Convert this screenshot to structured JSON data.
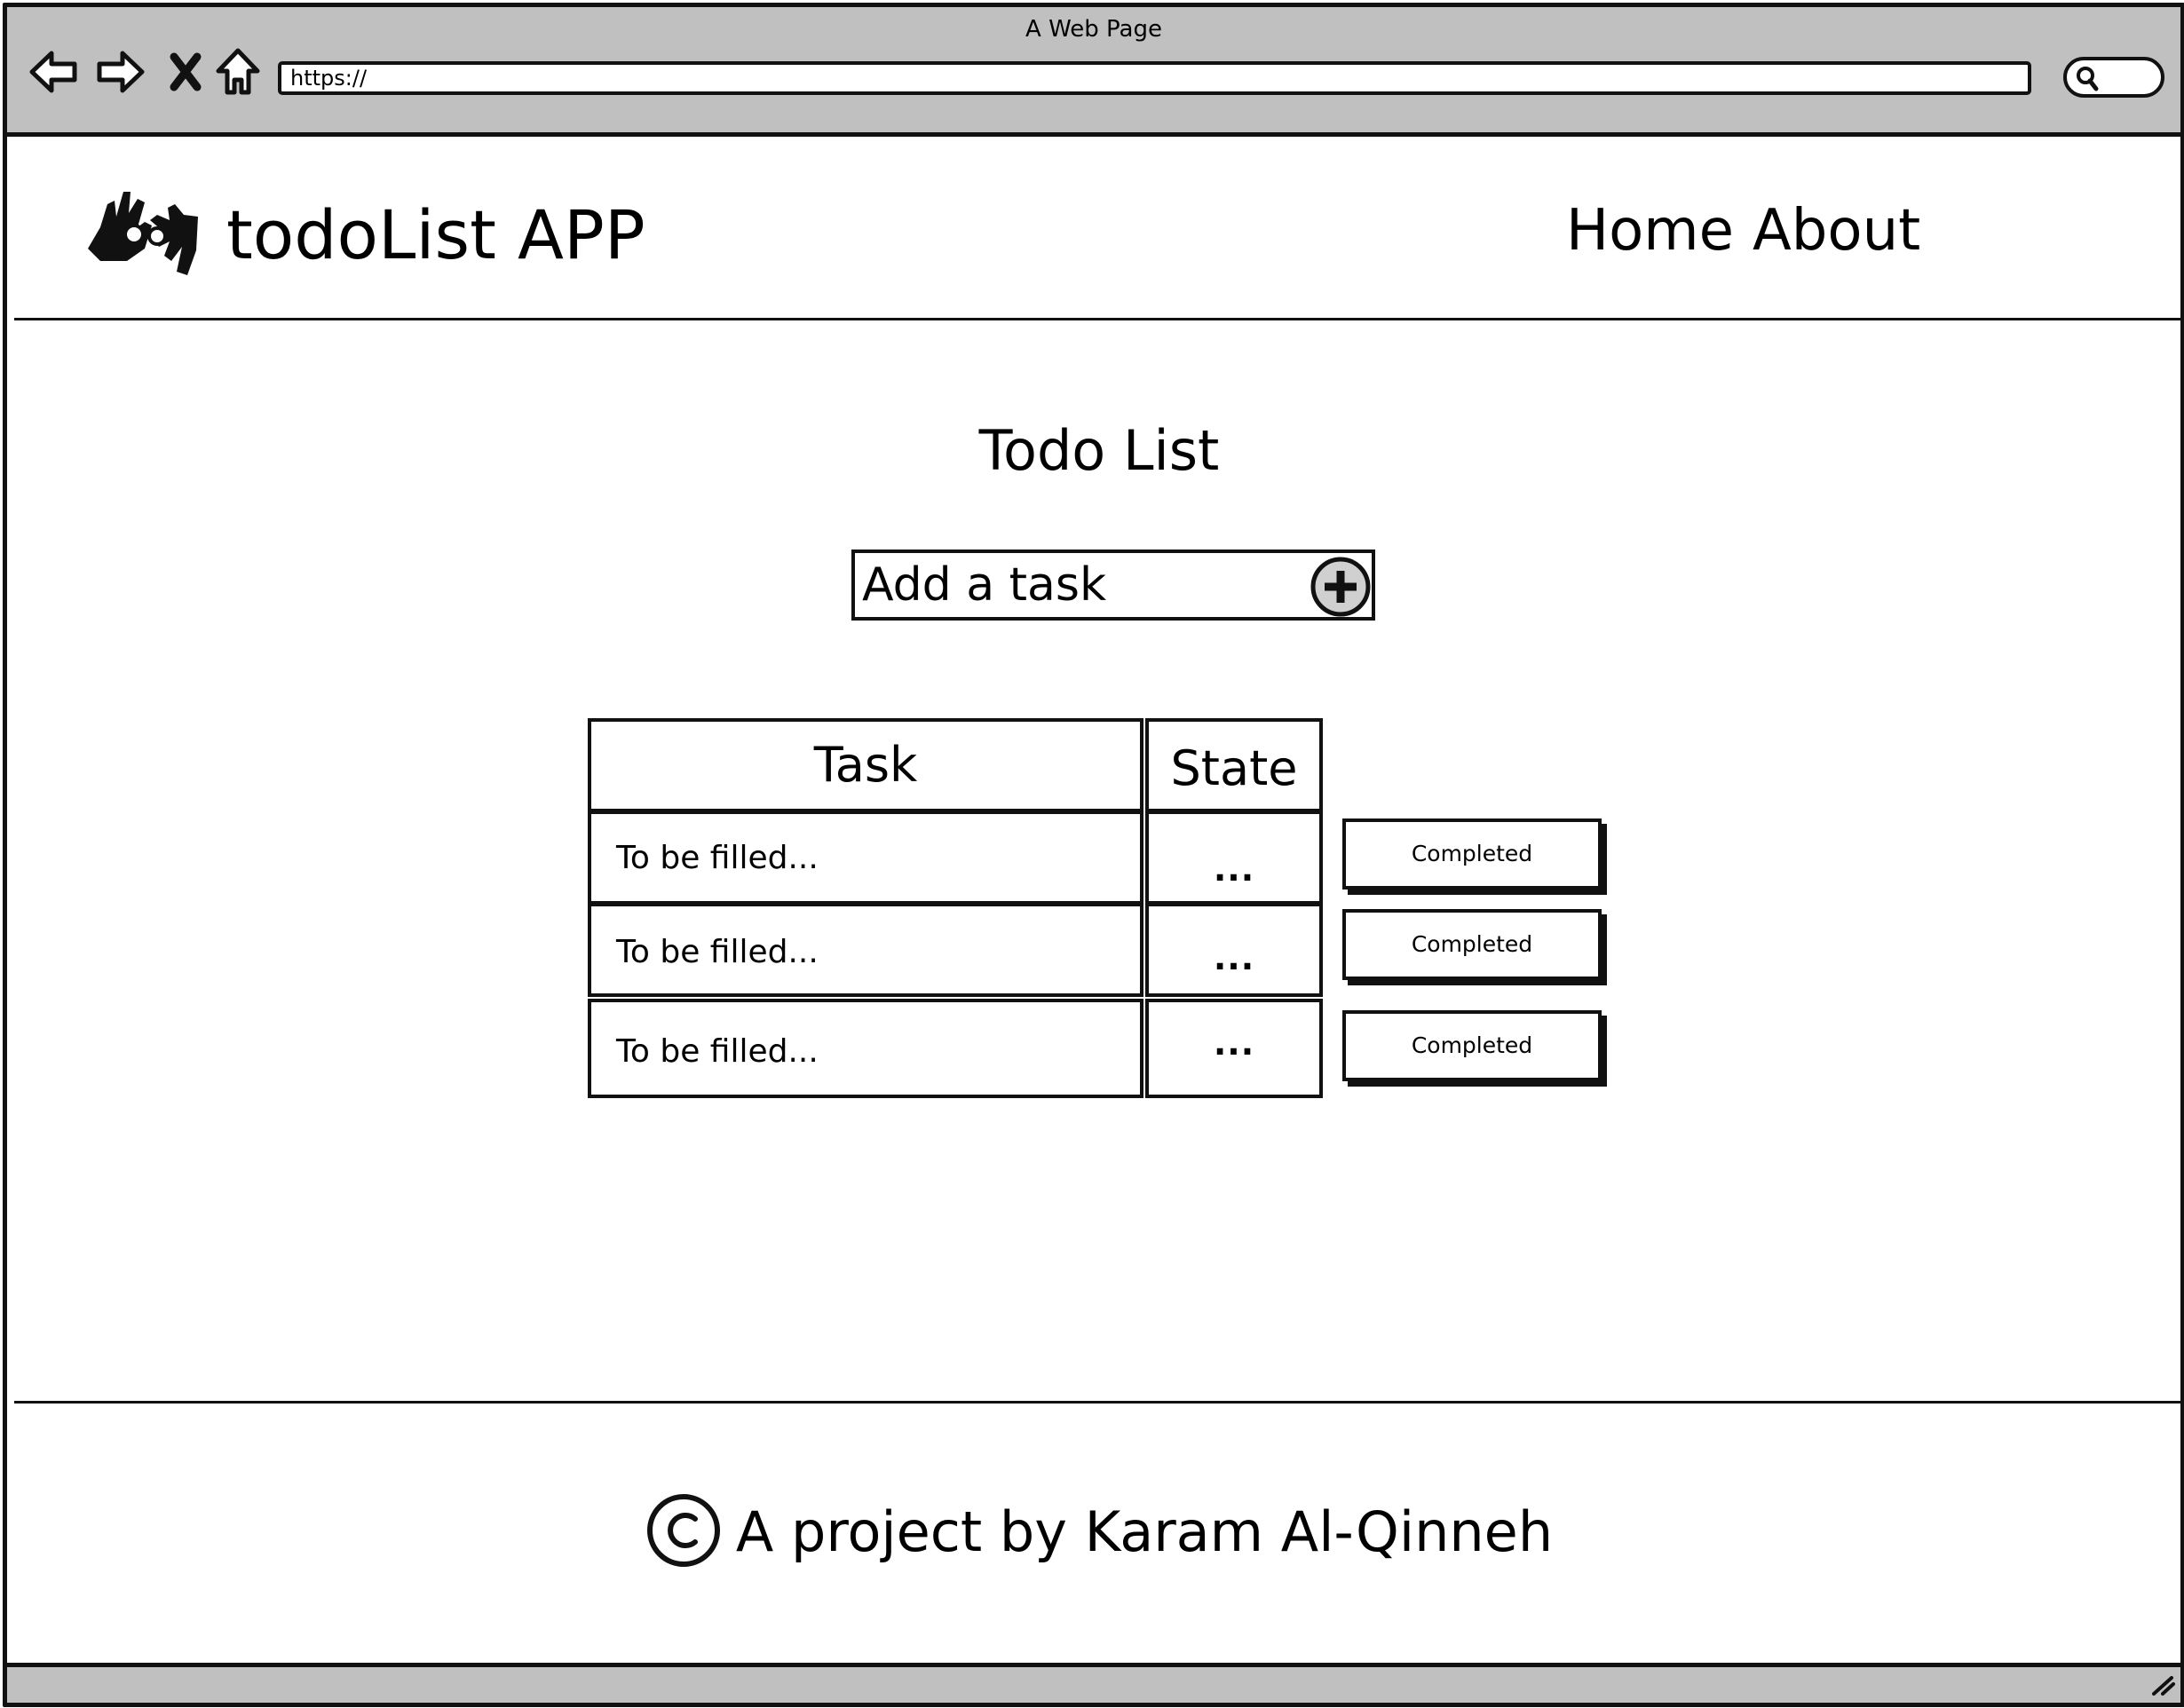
{
  "browser": {
    "window_title": "A Web Page",
    "url": "https://",
    "icons": [
      "back-arrow-icon",
      "forward-arrow-icon",
      "close-x-icon",
      "home-icon",
      "search-icon"
    ]
  },
  "header": {
    "logo_icon": "sign-language-hands-icon",
    "app_title": "todoList APP",
    "nav": [
      {
        "label": "Home"
      },
      {
        "label": "About"
      }
    ]
  },
  "main": {
    "title": "Todo List",
    "add_task": {
      "placeholder": "Add a task",
      "button_icon": "plus-circle-icon"
    },
    "table": {
      "headers": [
        "Task",
        "State"
      ],
      "rows": [
        {
          "task": "To be filled...",
          "state": "...",
          "action": "Completed"
        },
        {
          "task": "To be filled...",
          "state": "...",
          "action": "Completed"
        },
        {
          "task": "To be filled...",
          "state": "...",
          "action": "Completed"
        }
      ]
    }
  },
  "footer": {
    "icon": "copyright-icon",
    "text": "A project by Karam Al-Qinneh"
  },
  "colors": {
    "chrome_gray": "#c0c0c0",
    "stroke": "#111111",
    "button_gray": "#d0d0d0"
  }
}
